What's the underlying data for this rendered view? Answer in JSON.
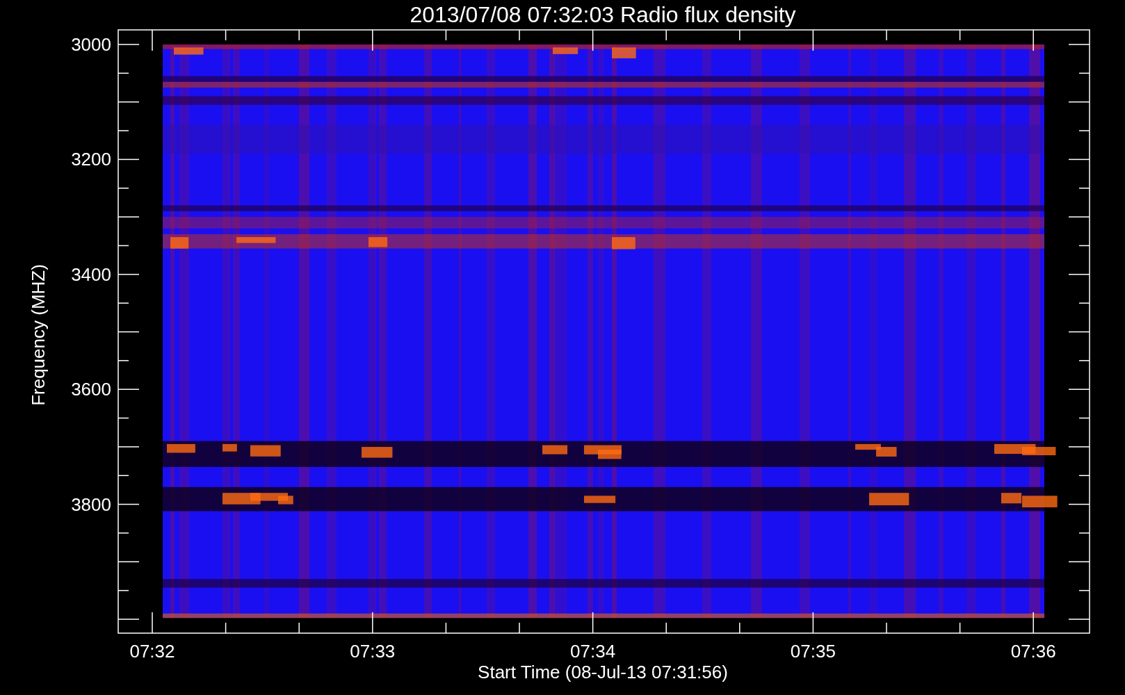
{
  "plot": {
    "title": "2013/07/08 07:32:03 Radio flux density",
    "y_axis": {
      "label": "Frequency (MHZ)",
      "ticks": [
        "3000",
        "3200",
        "3400",
        "3600",
        "3800"
      ]
    },
    "x_axis": {
      "label": "Start Time (08-Jul-13 07:31:56)",
      "ticks": [
        "07:32",
        "07:33",
        "07:34",
        "07:35",
        "07:36"
      ]
    }
  }
}
